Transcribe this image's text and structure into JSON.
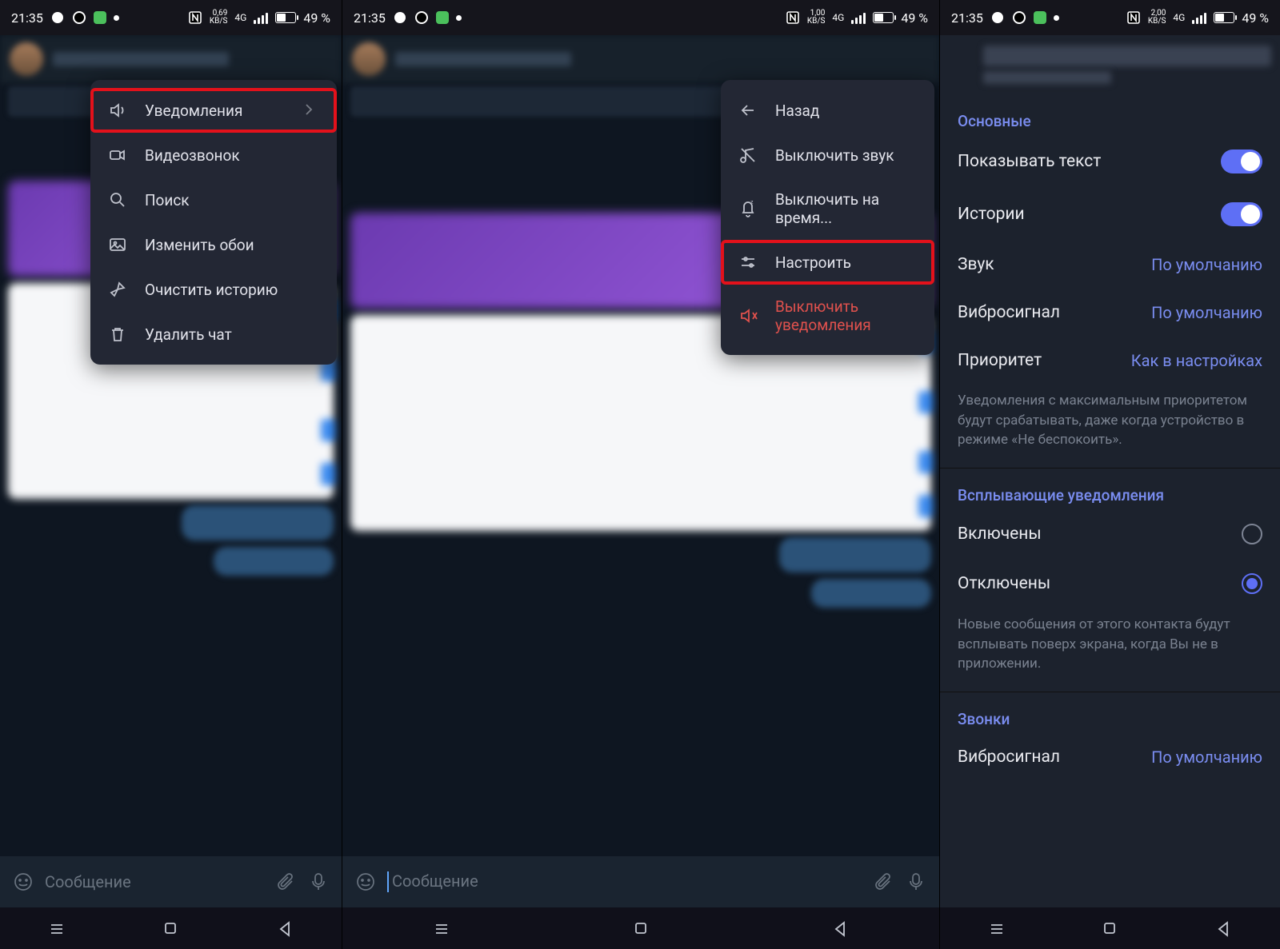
{
  "status": {
    "time": "21:35",
    "net_values": [
      "0,69",
      "1,00",
      "2,00"
    ],
    "net_unit": "KB/S",
    "signal": "4G",
    "battery": "49 %"
  },
  "screen1": {
    "menu": [
      {
        "label": "Уведомления",
        "icon": "speaker",
        "highlight": true,
        "chevron": true
      },
      {
        "label": "Видеозвонок",
        "icon": "videocam"
      },
      {
        "label": "Поиск",
        "icon": "search"
      },
      {
        "label": "Изменить обои",
        "icon": "image"
      },
      {
        "label": "Очистить историю",
        "icon": "broom"
      },
      {
        "label": "Удалить чат",
        "icon": "trash"
      }
    ],
    "input_placeholder": "Сообщение"
  },
  "screen2": {
    "menu": [
      {
        "label": "Назад",
        "icon": "arrow-left"
      },
      {
        "label": "Выключить звук",
        "icon": "music-off"
      },
      {
        "label": "Выключить на время...",
        "icon": "bell-snooze"
      },
      {
        "label": "Настроить",
        "icon": "sliders",
        "highlight": true
      },
      {
        "label": "Выключить уведомления",
        "icon": "speaker-off",
        "danger": true
      }
    ],
    "input_placeholder": "Сообщение"
  },
  "screen3": {
    "section1_title": "Основные",
    "rows1": [
      {
        "label": "Показывать текст",
        "type": "toggle",
        "on": true
      },
      {
        "label": "Истории",
        "type": "toggle",
        "on": true
      },
      {
        "label": "Звук",
        "type": "value",
        "value": "По умолчанию"
      },
      {
        "label": "Вибросигнал",
        "type": "value",
        "value": "По умолчанию"
      },
      {
        "label": "Приоритет",
        "type": "value",
        "value": "Как в настройках"
      }
    ],
    "desc1": "Уведомления с максимальным приоритетом будут срабатывать, даже когда устройство в режиме «Не беспокоить».",
    "section2_title": "Всплывающие уведомления",
    "rows2": [
      {
        "label": "Включены",
        "type": "radio",
        "on": false
      },
      {
        "label": "Отключены",
        "type": "radio",
        "on": true
      }
    ],
    "desc2": "Новые сообщения от этого контакта будут всплывать поверх экрана, когда Вы не в приложении.",
    "section3_title": "Звонки",
    "rows3": [
      {
        "label": "Вибросигнал",
        "type": "value",
        "value": "По умолчанию"
      }
    ]
  }
}
